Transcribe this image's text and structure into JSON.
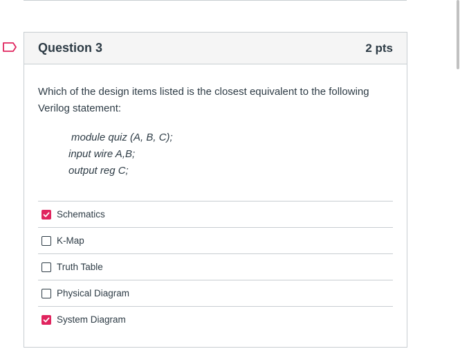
{
  "question": {
    "title": "Question 3",
    "points": "2 pts",
    "prompt": "Which of the design items listed is the closest equivalent to the following Verilog statement:",
    "code_lines": [
      "module quiz (A, B, C);",
      "input wire A,B;",
      "output reg C;"
    ],
    "answers": [
      {
        "label": "Schematics",
        "checked": true
      },
      {
        "label": "K-Map",
        "checked": false
      },
      {
        "label": "Truth Table",
        "checked": false
      },
      {
        "label": "Physical Diagram",
        "checked": false
      },
      {
        "label": "System Diagram",
        "checked": true
      }
    ]
  },
  "colors": {
    "checked": "#e0245e",
    "flag": "#e0245e",
    "border": "#c7cdd1",
    "header_bg": "#f5f5f5"
  },
  "icons": {
    "flag": "bookmark-flag-icon",
    "checkbox_checked": "checkmark-icon"
  }
}
